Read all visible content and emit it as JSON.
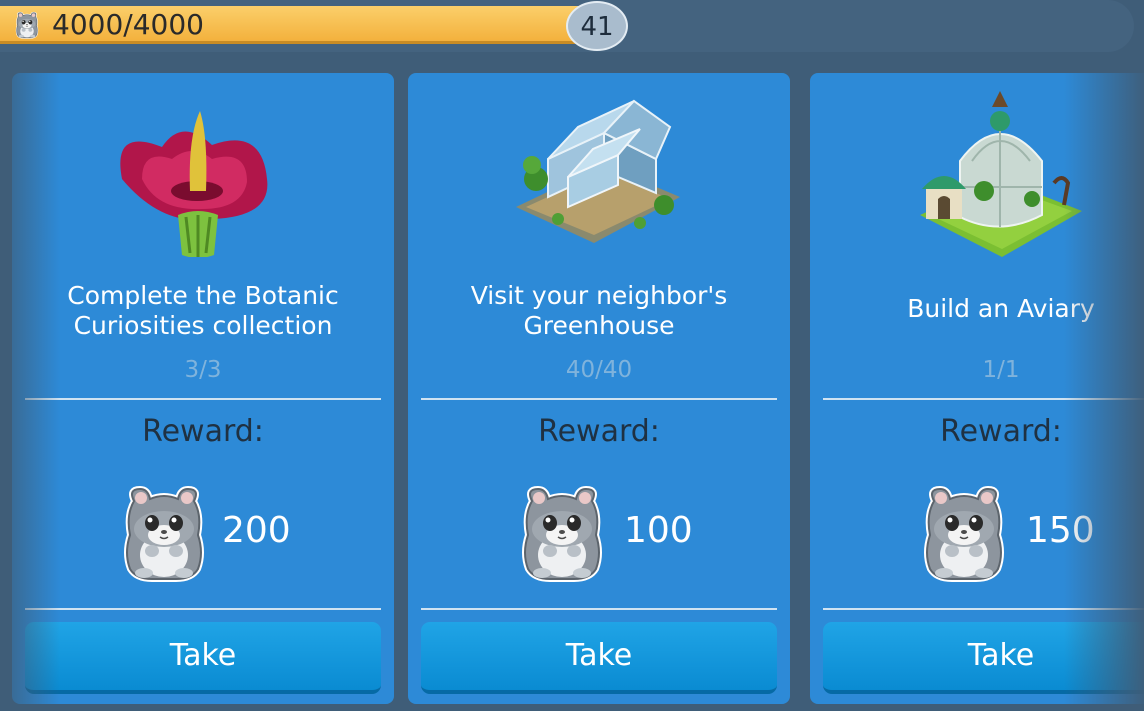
{
  "progress": {
    "text": "4000/4000",
    "fraction": 1.0,
    "icon": "hamster-icon"
  },
  "level": "41",
  "cards": [
    {
      "title_line1": "Complete the Botanic",
      "title_line2": "Curiosities collection",
      "count": "3/3",
      "reward_label": "Reward:",
      "amount": "200",
      "button": "Take",
      "image": "corpse-flower-image"
    },
    {
      "title_line1": "Visit your neighbor's",
      "title_line2": "Greenhouse",
      "count": "40/40",
      "reward_label": "Reward:",
      "amount": "100",
      "button": "Take",
      "image": "greenhouse-image"
    },
    {
      "title_line1": "Build an Aviary",
      "count": "1/1",
      "reward_label": "Reward:",
      "amount": "150",
      "button": "Take",
      "image": "aviary-image"
    }
  ],
  "colors": {
    "background": "#3f5d78",
    "card": "#2d8ad7",
    "progress": "#f3b13d",
    "button": "#12a0e6"
  }
}
